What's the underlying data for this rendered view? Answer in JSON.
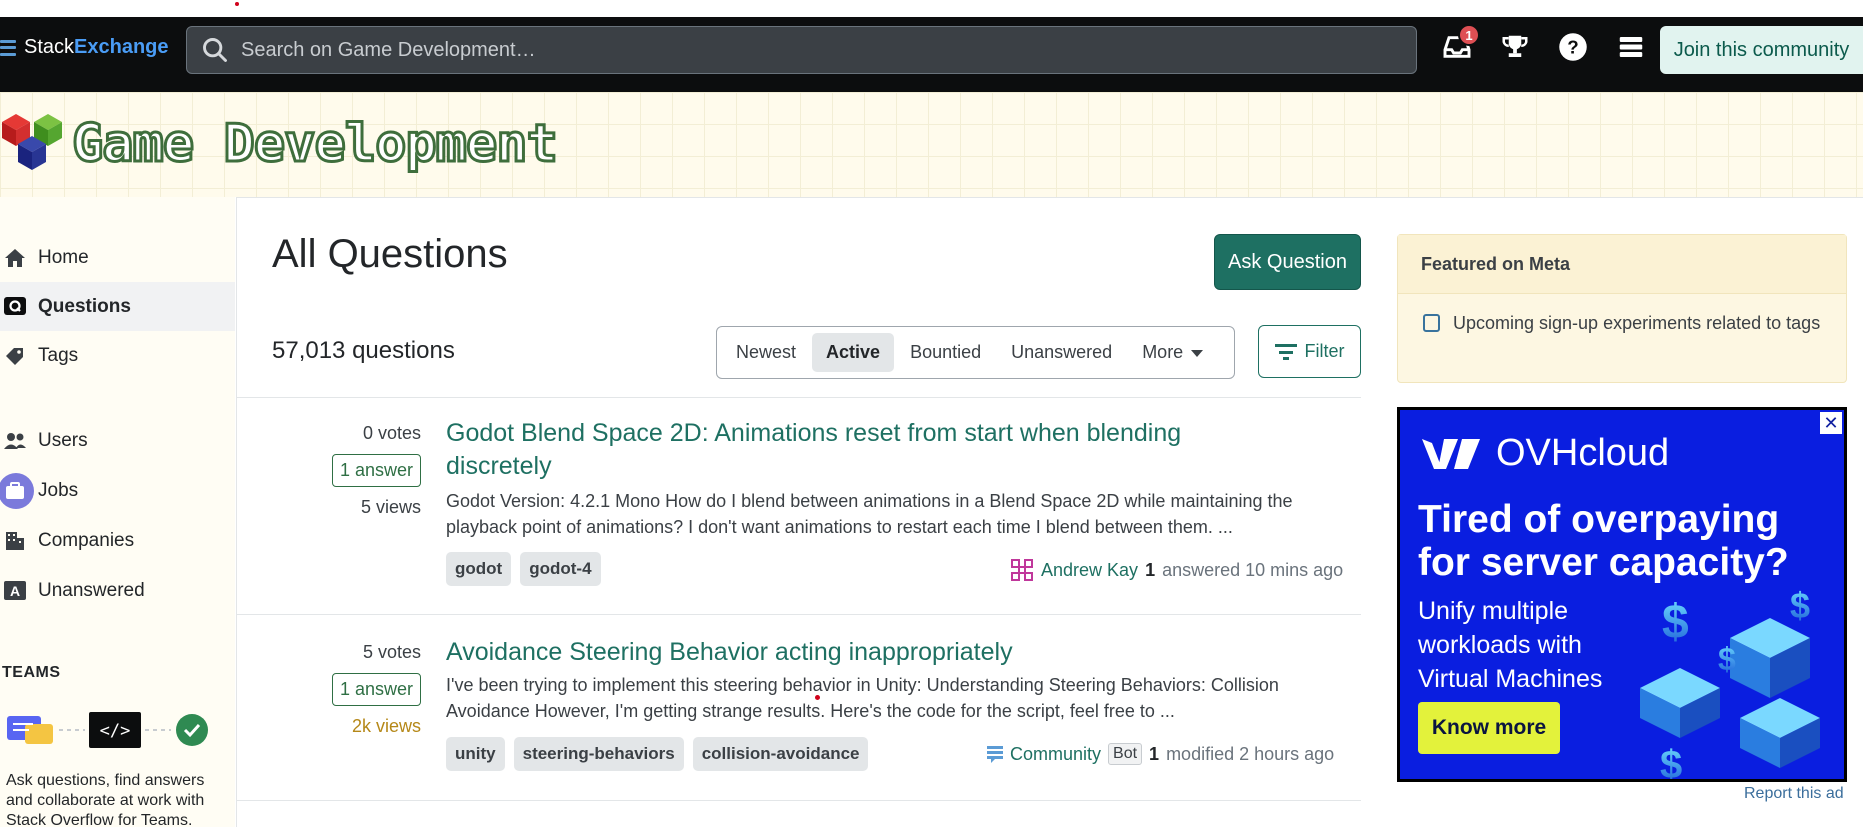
{
  "topbar": {
    "logo_stack": "Stack",
    "logo_exchange": "Exchange",
    "search_placeholder": "Search on Game Development…",
    "inbox_badge": "1",
    "join_label": "Join this community"
  },
  "site": {
    "title": "Game Development"
  },
  "sidebar": {
    "items": [
      {
        "label": "Home",
        "icon": "home-icon"
      },
      {
        "label": "Questions",
        "icon": "questions-icon",
        "active": true
      },
      {
        "label": "Tags",
        "icon": "tag-icon"
      },
      {
        "label": "Users",
        "icon": "users-icon"
      },
      {
        "label": "Jobs",
        "icon": "briefcase-icon"
      },
      {
        "label": "Companies",
        "icon": "building-icon"
      },
      {
        "label": "Unanswered",
        "icon": "unanswered-icon"
      }
    ],
    "teams_heading": "TEAMS",
    "teams_text": "Ask questions, find answers and collaborate at work with Stack Overflow for Teams."
  },
  "main": {
    "heading": "All Questions",
    "ask_button": "Ask Question",
    "question_count": "57,013 questions",
    "tabs": [
      "Newest",
      "Active",
      "Bountied",
      "Unanswered",
      "More"
    ],
    "active_tab": "Active",
    "filter_label": "Filter",
    "questions": [
      {
        "votes": "0 votes",
        "answers": "1 answer",
        "views": "5 views",
        "title": "Godot Blend Space 2D: Animations reset from start when blending discretely",
        "excerpt": "Godot Version: 4.2.1 Mono How do I blend between animations in a Blend Space 2D while maintaining the playback point of animations? I don't want animations to restart each time I blend between them. ...",
        "tags": [
          "godot",
          "godot-4"
        ],
        "user": "Andrew Kay",
        "rep": "1",
        "action": "answered 10 mins ago"
      },
      {
        "votes": "5 votes",
        "answers": "1 answer",
        "views": "2k views",
        "title": "Avoidance Steering Behavior acting inappropriately",
        "excerpt": "I've been trying to implement this steering behavior in Unity: Understanding Steering Behaviors: Collision Avoidance However, I'm getting strange results. Here's the code for the script, feel free to ...",
        "tags": [
          "unity",
          "steering-behaviors",
          "collision-avoidance"
        ],
        "user": "Community",
        "bot": "Bot",
        "rep": "1",
        "action": "modified 2 hours ago"
      }
    ]
  },
  "meta": {
    "heading": "Featured on Meta",
    "item": "Upcoming sign-up experiments related to tags"
  },
  "ad": {
    "brand": "OVHcloud",
    "headline": "Tired of overpaying for server capacity?",
    "sub": "Unify multiple workloads with Virtual Machines",
    "cta": "Know more",
    "report": "Report this ad"
  },
  "colors": {
    "accent": "#1e7062",
    "topbar": "#0c0d0e",
    "ad_bg": "#0a1ee0",
    "meta_bg": "#fdf7e2"
  }
}
